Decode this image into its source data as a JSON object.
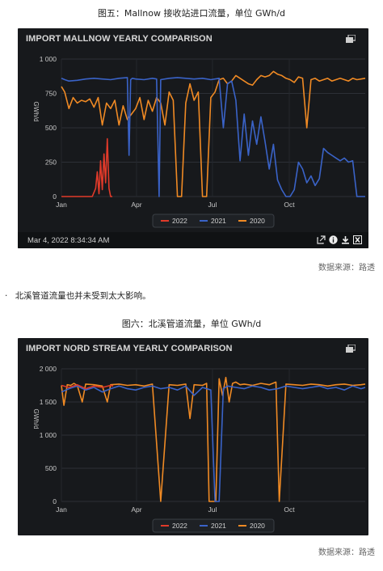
{
  "figure5_caption": "图五：Mallnow 接收站进口流量，单位 GWh/d",
  "figure6_caption": "图六：北溪管道流量，单位 GWh/d",
  "bullet_text": "北溪管道流量也并未受到太大影响。",
  "bullet_mark": "·",
  "source_label_1": "数据来源：路透",
  "source_label_2": "数据来源：路透",
  "chart1": {
    "title": "IMPORT MALLNOW YEARLY COMPARISON",
    "footer_timestamp": "Mar 4, 2022 8:34:34 AM",
    "icons": [
      "window-restore-icon",
      "external-link-icon",
      "info-icon",
      "download-icon",
      "excel-export-icon"
    ]
  },
  "chart2": {
    "title": "IMPORT NORD STREAM YEARLY COMPARISON",
    "icons": [
      "window-restore-icon"
    ]
  },
  "chart_data": [
    {
      "type": "line",
      "title": "IMPORT MALLNOW YEARLY COMPARISON",
      "ylabel": "GWh/d",
      "xlabel": "",
      "x_ticks": [
        "Jan",
        "Apr",
        "Jul",
        "Oct"
      ],
      "y_ticks": [
        "0",
        "250",
        "500",
        "750",
        "1 000"
      ],
      "ylim": [
        0,
        1000
      ],
      "x_unit": "day-of-year",
      "xlim": [
        1,
        365
      ],
      "legend": [
        "2022",
        "2021",
        "2020"
      ],
      "legend_position": "bottom",
      "grid": true,
      "series": [
        {
          "name": "2022",
          "color": "#e03a2a",
          "x": [
            1,
            10,
            20,
            30,
            38,
            42,
            44,
            46,
            48,
            50,
            52,
            54,
            56,
            58,
            60,
            62
          ],
          "y": [
            0,
            0,
            0,
            0,
            0,
            60,
            180,
            20,
            260,
            50,
            310,
            100,
            420,
            60,
            0,
            0
          ]
        },
        {
          "name": "2021",
          "color": "#3a63c8",
          "x": [
            1,
            5,
            10,
            20,
            30,
            40,
            50,
            60,
            70,
            80,
            82,
            84,
            86,
            90,
            100,
            110,
            115,
            118,
            120,
            130,
            140,
            150,
            160,
            170,
            180,
            190,
            195,
            200,
            205,
            210,
            215,
            220,
            225,
            230,
            235,
            240,
            245,
            250,
            255,
            260,
            265,
            270,
            275,
            280,
            285,
            290,
            295,
            300,
            305,
            310,
            315,
            320,
            325,
            330,
            335,
            340,
            345,
            350,
            355,
            360,
            365
          ],
          "y": [
            860,
            850,
            840,
            845,
            855,
            860,
            855,
            850,
            860,
            865,
            300,
            850,
            860,
            855,
            850,
            860,
            855,
            0,
            850,
            860,
            865,
            860,
            855,
            860,
            850,
            860,
            500,
            820,
            840,
            700,
            260,
            600,
            300,
            550,
            380,
            580,
            400,
            200,
            380,
            120,
            50,
            0,
            0,
            50,
            250,
            200,
            100,
            150,
            80,
            130,
            350,
            320,
            300,
            280,
            260,
            280,
            250,
            260,
            0,
            0,
            0
          ]
        },
        {
          "name": "2020",
          "color": "#f08a24",
          "x": [
            1,
            5,
            10,
            15,
            20,
            25,
            30,
            35,
            40,
            45,
            50,
            55,
            60,
            65,
            70,
            75,
            80,
            85,
            90,
            95,
            100,
            105,
            110,
            115,
            120,
            125,
            130,
            135,
            140,
            145,
            150,
            155,
            160,
            165,
            170,
            175,
            180,
            185,
            190,
            195,
            200,
            205,
            210,
            215,
            220,
            225,
            230,
            235,
            240,
            245,
            250,
            255,
            260,
            265,
            270,
            275,
            280,
            285,
            290,
            295,
            300,
            305,
            310,
            315,
            320,
            325,
            330,
            335,
            340,
            345,
            350,
            355,
            360,
            365
          ],
          "y": [
            800,
            760,
            640,
            720,
            680,
            700,
            690,
            710,
            650,
            720,
            520,
            680,
            640,
            700,
            520,
            660,
            560,
            600,
            640,
            720,
            560,
            700,
            620,
            720,
            680,
            520,
            760,
            700,
            0,
            0,
            680,
            820,
            700,
            760,
            0,
            0,
            720,
            760,
            850,
            860,
            820,
            840,
            880,
            860,
            840,
            820,
            810,
            850,
            880,
            870,
            880,
            910,
            890,
            880,
            860,
            850,
            830,
            870,
            860,
            500,
            850,
            860,
            840,
            850,
            860,
            840,
            850,
            860,
            850,
            840,
            860,
            850,
            855,
            860
          ]
        }
      ]
    },
    {
      "type": "line",
      "title": "IMPORT NORD STREAM YEARLY COMPARISON",
      "ylabel": "GWh/d",
      "xlabel": "",
      "x_ticks": [
        "Jan",
        "Apr",
        "Jul",
        "Oct"
      ],
      "y_ticks": [
        "0",
        "500",
        "1 000",
        "1 500",
        "2 000"
      ],
      "ylim": [
        0,
        2000
      ],
      "x_unit": "day-of-year",
      "xlim": [
        1,
        365
      ],
      "legend": [
        "2022",
        "2021",
        "2020"
      ],
      "legend_position": "bottom",
      "grid": true,
      "series": [
        {
          "name": "2022",
          "color": "#e03a2a",
          "x": [
            1,
            10,
            20,
            30,
            40,
            50,
            60,
            63
          ],
          "y": [
            1750,
            1720,
            1760,
            1700,
            1740,
            1720,
            1750,
            1740
          ]
        },
        {
          "name": "2021",
          "color": "#3a63c8",
          "x": [
            1,
            10,
            20,
            30,
            40,
            50,
            60,
            70,
            80,
            90,
            100,
            110,
            120,
            130,
            140,
            150,
            160,
            170,
            180,
            185,
            190,
            195,
            200,
            210,
            220,
            230,
            240,
            250,
            260,
            270,
            280,
            290,
            300,
            310,
            320,
            330,
            340,
            350,
            360,
            365
          ],
          "y": [
            1650,
            1700,
            1740,
            1680,
            1720,
            1650,
            1700,
            1740,
            1700,
            1680,
            1720,
            1740,
            1700,
            1720,
            1680,
            1740,
            1600,
            1720,
            1680,
            0,
            0,
            1700,
            1740,
            1720,
            1700,
            1740,
            1720,
            1680,
            1700,
            1740,
            1720,
            1700,
            1720,
            1740,
            1700,
            1720,
            1680,
            1740,
            1700,
            1720
          ]
        },
        {
          "name": "2020",
          "color": "#f08a24",
          "x": [
            1,
            4,
            8,
            12,
            16,
            20,
            26,
            30,
            40,
            50,
            56,
            60,
            70,
            80,
            90,
            100,
            110,
            120,
            130,
            140,
            150,
            155,
            160,
            170,
            175,
            178,
            182,
            186,
            190,
            194,
            198,
            202,
            206,
            210,
            215,
            220,
            230,
            240,
            250,
            258,
            262,
            270,
            280,
            290,
            300,
            310,
            320,
            330,
            340,
            350,
            360,
            365
          ],
          "y": [
            1750,
            1450,
            1760,
            1750,
            1780,
            1750,
            1500,
            1770,
            1760,
            1740,
            1500,
            1760,
            1770,
            1750,
            1760,
            1740,
            1770,
            0,
            1760,
            1750,
            1770,
            1250,
            1760,
            1750,
            1780,
            0,
            0,
            0,
            1850,
            1600,
            1870,
            1500,
            1780,
            1800,
            1760,
            1770,
            1750,
            1780,
            1760,
            1800,
            0,
            1770,
            1760,
            1750,
            1770,
            1760,
            1740,
            1760,
            1770,
            1750,
            1760,
            1770
          ]
        }
      ]
    }
  ]
}
